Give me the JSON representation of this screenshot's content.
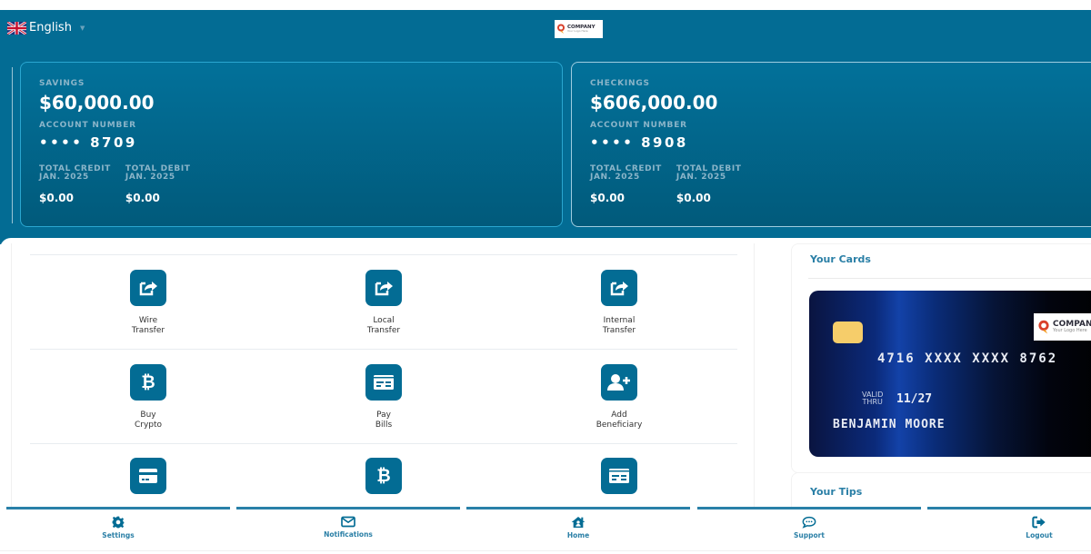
{
  "header": {
    "language": "English",
    "flag_icon": "uk-flag-icon",
    "logo": {
      "name": "COMPANY",
      "tagline": "Your Logo Here"
    }
  },
  "accounts": [
    {
      "type": "SAVINGS",
      "balance": "$60,000.00",
      "account_number_label": "ACCOUNT NUMBER",
      "account_number": "•••• 8709",
      "total_credit_label": "TOTAL CREDIT",
      "total_debit_label": "TOTAL DEBIT",
      "period": "JAN. 2025",
      "total_credit": "$0.00",
      "total_debit": "$0.00"
    },
    {
      "type": "CHECKINGS",
      "balance": "$606,000.00",
      "account_number_label": "ACCOUNT NUMBER",
      "account_number": "•••• 8908",
      "total_credit_label": "TOTAL CREDIT",
      "total_debit_label": "TOTAL DEBIT",
      "period": "JAN. 2025",
      "total_credit": "$0.00",
      "total_debit": "$0.00"
    }
  ],
  "actions": [
    {
      "label": "Wire\nTransfer",
      "icon": "share-square-icon"
    },
    {
      "label": "Local\nTransfer",
      "icon": "share-square-icon"
    },
    {
      "label": "Internal\nTransfer",
      "icon": "share-square-icon"
    },
    {
      "label": "Buy\nCrypto",
      "icon": "bitcoin-icon"
    },
    {
      "label": "Pay\nBills",
      "icon": "money-check-icon"
    },
    {
      "label": "Add\nBeneficiary",
      "icon": "user-plus-icon"
    },
    {
      "label": "",
      "icon": "credit-card-icon"
    },
    {
      "label": "",
      "icon": "bitcoin-icon"
    },
    {
      "label": "",
      "icon": "money-check-icon"
    }
  ],
  "sidebar": {
    "cards_title": "Your Cards",
    "tips_title": "Your Tips",
    "card": {
      "number": "4716 XXXX XXXX 8762",
      "valid_label_1": "VALID",
      "valid_label_2": "THRU",
      "expiry": "11/27",
      "holder": "BENJAMIN MOORE",
      "logo_name": "COMPANY",
      "logo_tagline": "Your Logo Here"
    }
  },
  "bottom_nav": [
    {
      "label": "Settings",
      "icon": "gear-icon"
    },
    {
      "label": "Notifications",
      "icon": "envelope-icon"
    },
    {
      "label": "Home",
      "icon": "home-icon"
    },
    {
      "label": "Support",
      "icon": "chat-icon"
    },
    {
      "label": "Logout",
      "icon": "logout-icon"
    }
  ],
  "colors": {
    "brand": "#036c94",
    "accent_text": "#2a7fa6",
    "card_chip": "#f6cd6a"
  }
}
